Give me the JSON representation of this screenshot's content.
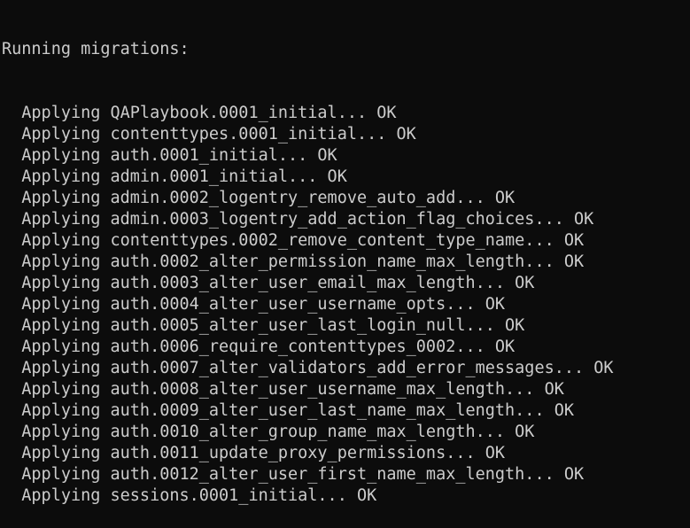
{
  "terminal": {
    "header": "Running migrations:",
    "lines": [
      "  Applying QAPlaybook.0001_initial... OK",
      "  Applying contenttypes.0001_initial... OK",
      "  Applying auth.0001_initial... OK",
      "  Applying admin.0001_initial... OK",
      "  Applying admin.0002_logentry_remove_auto_add... OK",
      "  Applying admin.0003_logentry_add_action_flag_choices... OK",
      "  Applying contenttypes.0002_remove_content_type_name... OK",
      "  Applying auth.0002_alter_permission_name_max_length... OK",
      "  Applying auth.0003_alter_user_email_max_length... OK",
      "  Applying auth.0004_alter_user_username_opts... OK",
      "  Applying auth.0005_alter_user_last_login_null... OK",
      "  Applying auth.0006_require_contenttypes_0002... OK",
      "  Applying auth.0007_alter_validators_add_error_messages... OK",
      "  Applying auth.0008_alter_user_username_max_length... OK",
      "  Applying auth.0009_alter_user_last_name_max_length... OK",
      "  Applying auth.0010_alter_group_name_max_length... OK",
      "  Applying auth.0011_update_proxy_permissions... OK",
      "  Applying auth.0012_alter_user_first_name_max_length... OK",
      "  Applying sessions.0001_initial... OK"
    ]
  }
}
